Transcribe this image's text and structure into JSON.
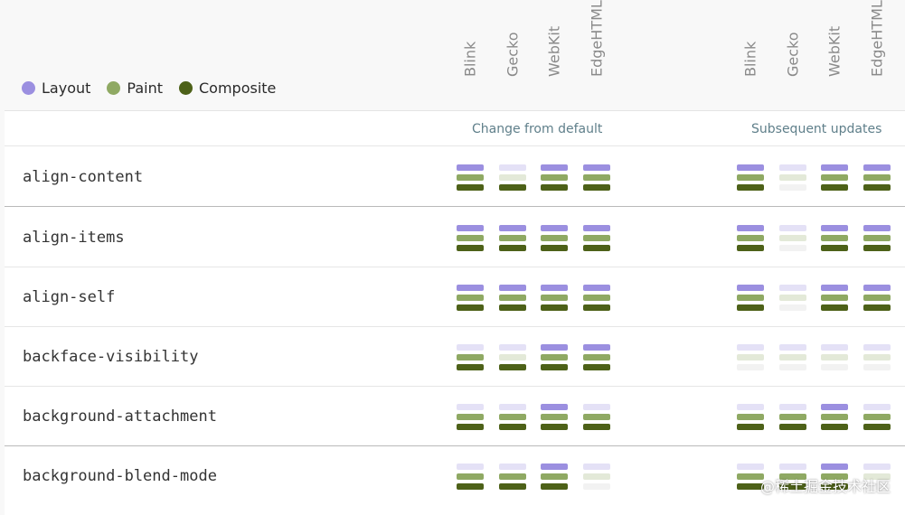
{
  "colors": {
    "layout": "#9b8fe0",
    "paint": "#8fa963",
    "composite": "#4d6118",
    "layout_faded": "#e4e1f6",
    "paint_faded": "#e3e9d8",
    "composite_faded": "#f2f2f2"
  },
  "legend": [
    {
      "label": "Layout",
      "key": "layout"
    },
    {
      "label": "Paint",
      "key": "paint"
    },
    {
      "label": "Composite",
      "key": "composite"
    }
  ],
  "engines": [
    "Blink",
    "Gecko",
    "WebKit",
    "EdgeHTML"
  ],
  "groups": [
    {
      "label": "Change from default"
    },
    {
      "label": "Subsequent updates"
    }
  ],
  "rows": [
    {
      "name": "align-content",
      "change": [
        [
          1,
          1,
          1
        ],
        [
          0,
          0,
          1
        ],
        [
          1,
          1,
          1
        ],
        [
          1,
          1,
          1
        ]
      ],
      "subsequent": [
        [
          1,
          1,
          1
        ],
        [
          0,
          0,
          0
        ],
        [
          1,
          1,
          1
        ],
        [
          1,
          1,
          1
        ]
      ]
    },
    {
      "name": "align-items",
      "change": [
        [
          1,
          1,
          1
        ],
        [
          1,
          1,
          1
        ],
        [
          1,
          1,
          1
        ],
        [
          1,
          1,
          1
        ]
      ],
      "subsequent": [
        [
          1,
          1,
          1
        ],
        [
          0,
          0,
          0
        ],
        [
          1,
          1,
          1
        ],
        [
          1,
          1,
          1
        ]
      ]
    },
    {
      "name": "align-self",
      "change": [
        [
          1,
          1,
          1
        ],
        [
          1,
          1,
          1
        ],
        [
          1,
          1,
          1
        ],
        [
          1,
          1,
          1
        ]
      ],
      "subsequent": [
        [
          1,
          1,
          1
        ],
        [
          0,
          0,
          0
        ],
        [
          1,
          1,
          1
        ],
        [
          1,
          1,
          1
        ]
      ]
    },
    {
      "name": "backface-visibility",
      "change": [
        [
          0,
          1,
          1
        ],
        [
          0,
          0,
          1
        ],
        [
          1,
          1,
          1
        ],
        [
          1,
          1,
          1
        ]
      ],
      "subsequent": [
        [
          0,
          0,
          0
        ],
        [
          0,
          0,
          0
        ],
        [
          0,
          0,
          0
        ],
        [
          0,
          0,
          0
        ]
      ]
    },
    {
      "name": "background-attachment",
      "change": [
        [
          0,
          1,
          1
        ],
        [
          0,
          1,
          1
        ],
        [
          1,
          1,
          1
        ],
        [
          0,
          1,
          1
        ]
      ],
      "subsequent": [
        [
          0,
          1,
          1
        ],
        [
          0,
          1,
          1
        ],
        [
          1,
          1,
          1
        ],
        [
          0,
          1,
          1
        ]
      ]
    },
    {
      "name": "background-blend-mode",
      "change": [
        [
          0,
          1,
          1
        ],
        [
          0,
          1,
          1
        ],
        [
          1,
          1,
          1
        ],
        [
          0,
          0,
          0
        ]
      ],
      "subsequent": [
        [
          0,
          1,
          1
        ],
        [
          0,
          1,
          1
        ],
        [
          1,
          1,
          1
        ],
        [
          0,
          0,
          0
        ]
      ]
    }
  ],
  "watermark": "@稀土掘金技术社区"
}
